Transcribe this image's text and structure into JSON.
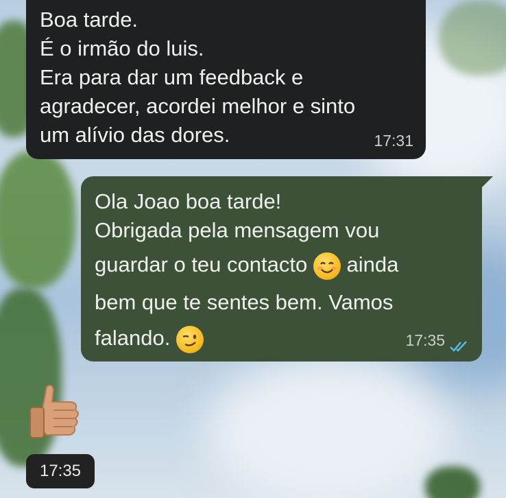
{
  "messages": [
    {
      "direction": "incoming",
      "lines": [
        "Boa tarde.",
        "É o irmão do luis.",
        "Era para dar um feedback e",
        "agradecer, acordei melhor e sinto",
        "um alívio das dores."
      ],
      "time": "17:31"
    },
    {
      "direction": "outgoing",
      "lines": [
        "Ola Joao boa tarde!",
        "Obrigada pela mensagem vou",
        "guardar o teu contacto",
        "ainda",
        "bem que te sentes bem. Vamos",
        "falando."
      ],
      "emojis": [
        "smiling-face-emoji",
        "winking-face-emoji"
      ],
      "time": "17:35",
      "status": "read"
    },
    {
      "direction": "incoming",
      "sticker": "thumbs-up-emoji",
      "time": "17:35"
    }
  ],
  "colors": {
    "incoming_bubble": "#1f2022",
    "outgoing_bubble": "#3d5038",
    "read_ticks": "#53bdeb"
  }
}
